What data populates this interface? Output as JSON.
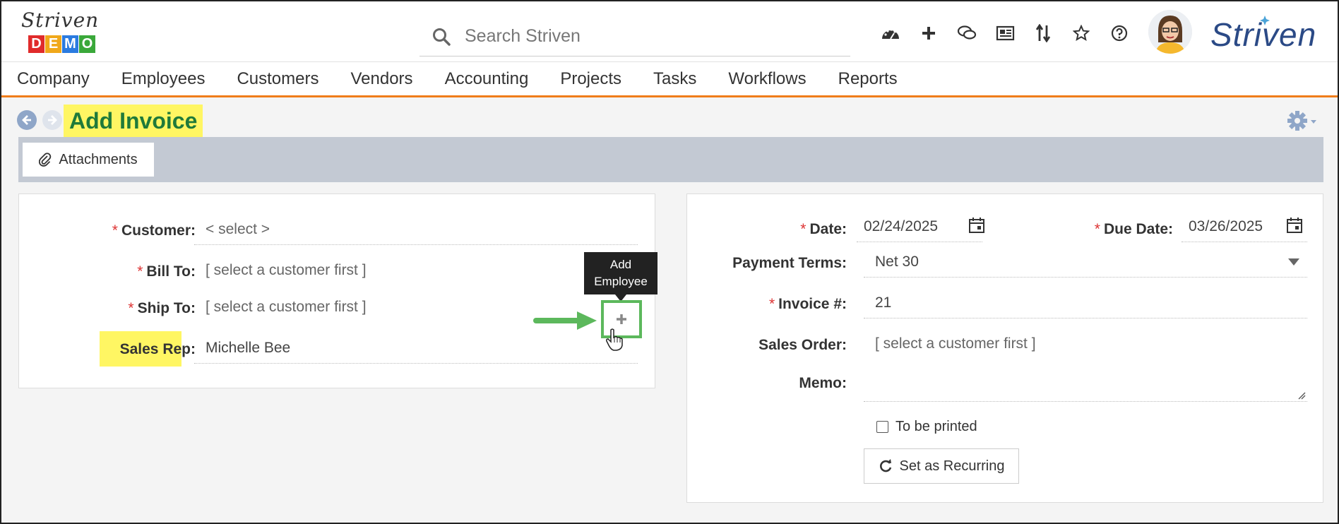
{
  "header": {
    "logo_script": "Striven",
    "logo_demo_letters": [
      "D",
      "E",
      "M",
      "O"
    ],
    "logo_demo_colors": [
      "#e02b2b",
      "#f0a81a",
      "#2b7be0",
      "#3aa83a"
    ],
    "search_placeholder": "Search Striven",
    "brand": "Striven",
    "icons": [
      "dashboard-icon",
      "plus-icon",
      "chat-icon",
      "news-icon",
      "sort-icon",
      "star-icon",
      "help-icon"
    ]
  },
  "nav": {
    "items": [
      "Company",
      "Employees",
      "Customers",
      "Vendors",
      "Accounting",
      "Projects",
      "Tasks",
      "Workflows",
      "Reports"
    ]
  },
  "page": {
    "title": "Add Invoice",
    "attachments_label": "Attachments"
  },
  "left_form": {
    "customer_label": "Customer:",
    "customer_value": "< select >",
    "bill_to_label": "Bill To:",
    "bill_to_value": "[ select a customer first ]",
    "ship_to_label": "Ship To:",
    "ship_to_value": "[ select a customer first ]",
    "sales_rep_label": "Sales Rep:",
    "sales_rep_value": "Michelle Bee",
    "tooltip_line1": "Add",
    "tooltip_line2": "Employee",
    "add_button_symbol": "+"
  },
  "right_form": {
    "date_label": "Date:",
    "date_value": "02/24/2025",
    "due_date_label": "Due Date:",
    "due_date_value": "03/26/2025",
    "payment_terms_label": "Payment Terms:",
    "payment_terms_value": "Net 30",
    "invoice_label": "Invoice #:",
    "invoice_value": "21",
    "sales_order_label": "Sales Order:",
    "sales_order_value": "[ select a customer first ]",
    "memo_label": "Memo:",
    "to_be_printed_label": "To be printed",
    "recurring_label": "Set as Recurring"
  },
  "colors": {
    "accent_orange": "#f07d1a",
    "title_green": "#1f7a3a",
    "highlight_yellow": "#fff663",
    "brand_blue": "#2b4a86",
    "callout_green": "#5cb85c"
  }
}
